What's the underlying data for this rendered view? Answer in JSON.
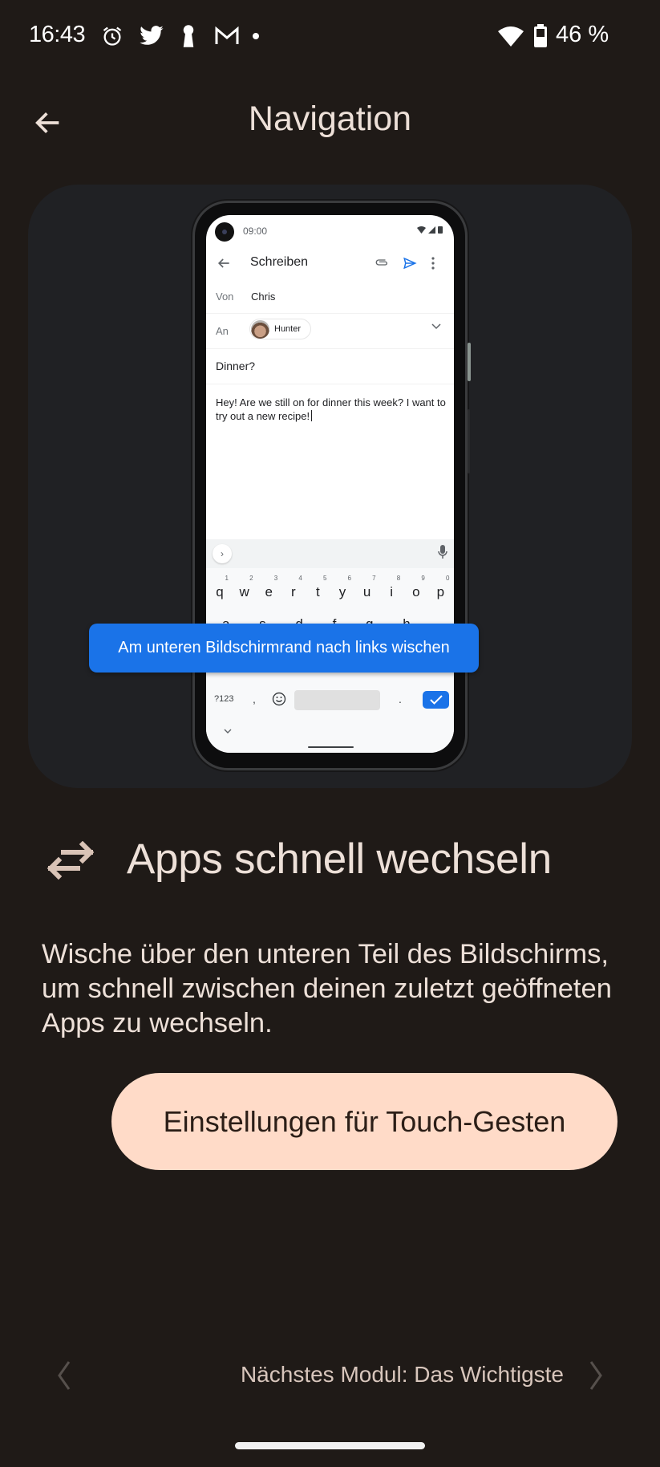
{
  "status_bar": {
    "time": "16:43",
    "battery_percent": "46 %",
    "notification_icons": [
      "alarm-icon",
      "twitter-icon",
      "keyhole-icon",
      "gmail-icon",
      "more-dot-icon"
    ],
    "system_icons": [
      "wifi-icon",
      "battery-icon"
    ]
  },
  "header": {
    "back_icon": "arrow-left-icon",
    "title": "Navigation"
  },
  "illustration": {
    "phone": {
      "time": "09:00",
      "toolbar_title": "Schreiben",
      "from_label": "Von",
      "from_value": "Chris",
      "to_label": "An",
      "to_chip": "Hunter",
      "subject": "Dinner?",
      "body": "Hey! Are we still on for dinner this week? I want to try out a new recipe!",
      "keyboard": {
        "keys": [
          "q",
          "w",
          "e",
          "r",
          "t",
          "y",
          "u",
          "i",
          "o",
          "p"
        ],
        "numbers": [
          "1",
          "2",
          "3",
          "4",
          "5",
          "6",
          "7",
          "8",
          "9",
          "0"
        ],
        "second_row": "a s d f g h j k l",
        "symbols_key": "?123",
        "comma": ",",
        "period": "."
      }
    },
    "hint_banner": "Am unteren Bildschirmrand nach links wischen",
    "banner_color": "#1a73e8"
  },
  "section": {
    "icon": "swap-horiz-icon",
    "title": "Apps schnell wechseln",
    "body": "Wische über den unteren Teil des Bildschirms, um schnell zwischen deinen zuletzt geöffneten Apps zu wechseln."
  },
  "action_button": {
    "label": "Einstellungen für Touch-Gesten",
    "color": "#ffdbc8"
  },
  "bottom_nav": {
    "prev_icon": "chevron-left-icon",
    "next_label": "Nächstes Modul: Das Wichtigste",
    "next_icon": "chevron-right-icon"
  }
}
